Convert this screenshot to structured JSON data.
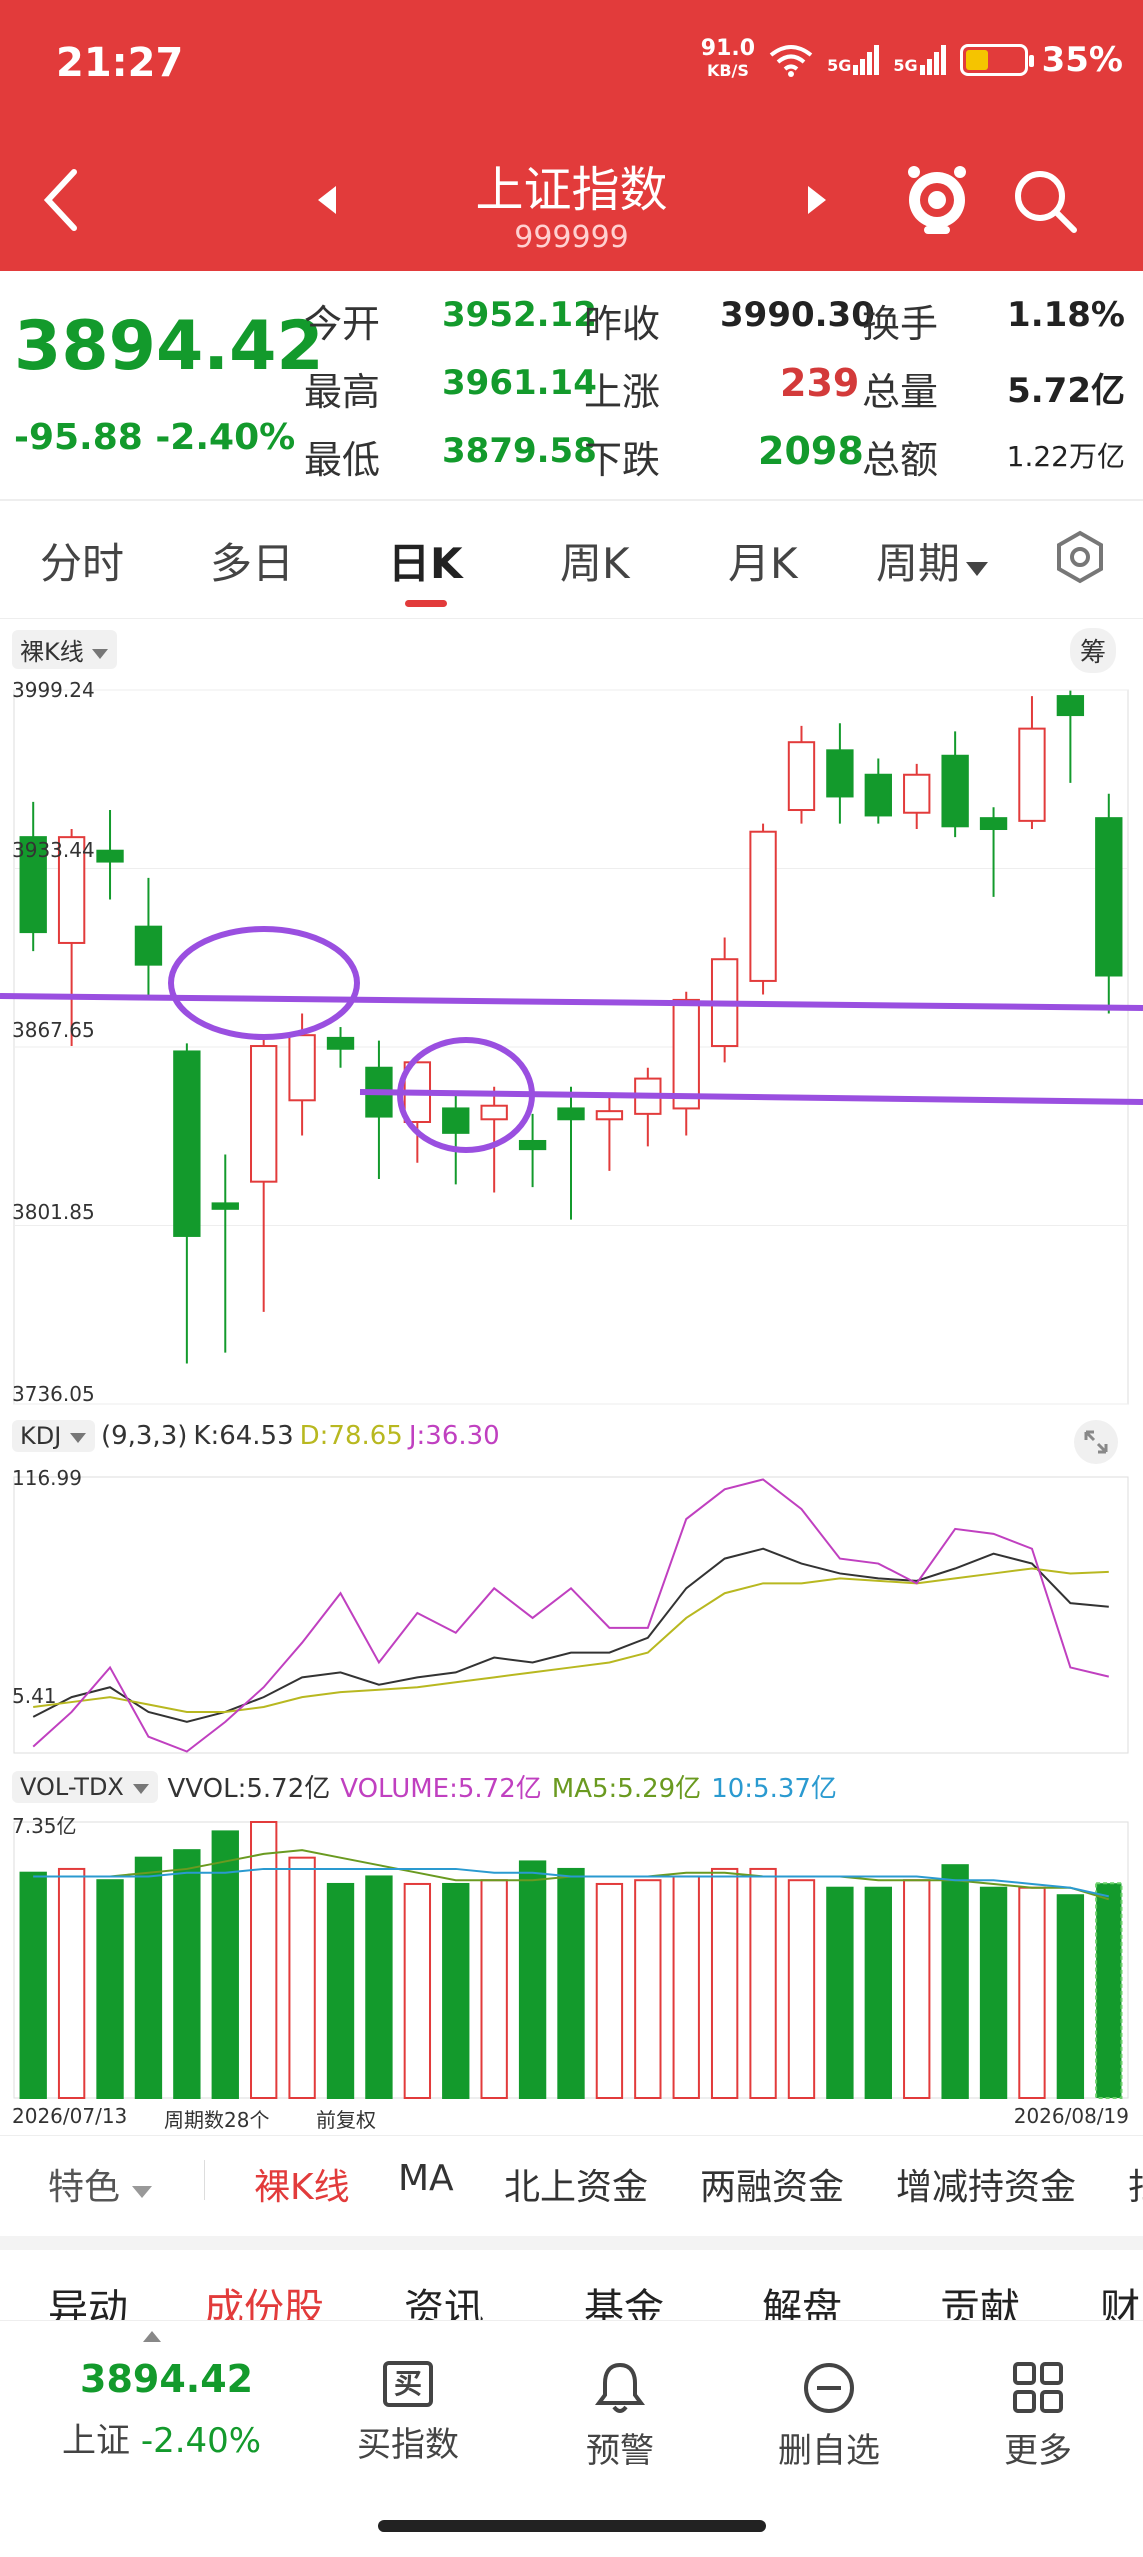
{
  "status_bar": {
    "time": "21:27",
    "speed": "91.0",
    "speed_unit": "KB/S",
    "battery": "35%",
    "network1": "5G",
    "network2": "5G"
  },
  "header": {
    "title": "上证指数",
    "code": "999999"
  },
  "quote": {
    "price": "3894.42",
    "change": "-95.88",
    "change_pct": "-2.40%",
    "open_label": "今开",
    "open": "3952.12",
    "prev_close_label": "昨收",
    "prev_close": "3990.30",
    "turnover_label": "换手",
    "turnover": "1.18%",
    "high_label": "最高",
    "high": "3961.14",
    "up_label": "上涨",
    "up": "239",
    "volume_label": "总量",
    "volume": "5.72亿",
    "low_label": "最低",
    "low": "3879.58",
    "down_label": "下跌",
    "down": "2098",
    "amount_label": "总额",
    "amount": "1.22万亿"
  },
  "tabs": [
    "分时",
    "多日",
    "日K",
    "周K",
    "月K",
    "周期"
  ],
  "kline": {
    "style_label": "裸K线",
    "chip_label": "筹",
    "y_labels": [
      "3999.24",
      "3933.44",
      "3867.65",
      "3801.85",
      "3736.05"
    ],
    "candles": [
      {
        "o": 3945,
        "c": 3910,
        "h": 3958,
        "l": 3903
      },
      {
        "o": 3906,
        "c": 3945,
        "h": 3948,
        "l": 3868
      },
      {
        "o": 3940,
        "c": 3936,
        "h": 3955,
        "l": 3922
      },
      {
        "o": 3912,
        "c": 3898,
        "h": 3930,
        "l": 3885
      },
      {
        "o": 3866,
        "c": 3798,
        "h": 3869,
        "l": 3751
      },
      {
        "o": 3810,
        "c": 3808,
        "h": 3828,
        "l": 3755
      },
      {
        "o": 3818,
        "c": 3868,
        "h": 3872,
        "l": 3770
      },
      {
        "o": 3848,
        "c": 3872,
        "h": 3880,
        "l": 3835
      },
      {
        "o": 3871,
        "c": 3867,
        "h": 3875,
        "l": 3860
      },
      {
        "o": 3860,
        "c": 3842,
        "h": 3870,
        "l": 3819
      },
      {
        "o": 3840,
        "c": 3862,
        "h": 3862,
        "l": 3825
      },
      {
        "o": 3845,
        "c": 3836,
        "h": 3850,
        "l": 3817
      },
      {
        "o": 3841,
        "c": 3846,
        "h": 3853,
        "l": 3814
      },
      {
        "o": 3833,
        "c": 3830,
        "h": 3843,
        "l": 3816
      },
      {
        "o": 3845,
        "c": 3841,
        "h": 3853,
        "l": 3804
      },
      {
        "o": 3841,
        "c": 3844,
        "h": 3850,
        "l": 3822
      },
      {
        "o": 3843,
        "c": 3856,
        "h": 3860,
        "l": 3831
      },
      {
        "o": 3845,
        "c": 3885,
        "h": 3888,
        "l": 3835
      },
      {
        "o": 3868,
        "c": 3900,
        "h": 3908,
        "l": 3862
      },
      {
        "o": 3892,
        "c": 3947,
        "h": 3950,
        "l": 3887
      },
      {
        "o": 3955,
        "c": 3980,
        "h": 3986,
        "l": 3950
      },
      {
        "o": 3977,
        "c": 3960,
        "h": 3987,
        "l": 3950
      },
      {
        "o": 3968,
        "c": 3953,
        "h": 3974,
        "l": 3950
      },
      {
        "o": 3954,
        "c": 3968,
        "h": 3972,
        "l": 3948
      },
      {
        "o": 3975,
        "c": 3949,
        "h": 3984,
        "l": 3945
      },
      {
        "o": 3952,
        "c": 3948,
        "h": 3956,
        "l": 3923
      },
      {
        "o": 3951,
        "c": 3985,
        "h": 3997,
        "l": 3948
      },
      {
        "o": 3997,
        "c": 3990,
        "h": 3999,
        "l": 3965
      },
      {
        "o": 3952,
        "c": 3894,
        "h": 3961,
        "l": 3880
      }
    ]
  },
  "kdj": {
    "label": "KDJ",
    "params": "(9,3,3)",
    "k_text": "K:64.53",
    "d_text": "D:78.65",
    "j_text": "J:36.30",
    "y_max": "116.99",
    "y_min": "5.41",
    "color_k": "#333333",
    "color_d": "#b8b820",
    "color_j": "#c040c0",
    "k": [
      20,
      28,
      32,
      22,
      18,
      22,
      28,
      36,
      38,
      33,
      36,
      38,
      44,
      42,
      46,
      46,
      52,
      72,
      84,
      88,
      82,
      78,
      76,
      75,
      80,
      86,
      82,
      66,
      64.53
    ],
    "d": [
      24,
      26,
      28,
      25,
      22,
      22,
      24,
      28,
      30,
      31,
      32,
      34,
      36,
      38,
      40,
      42,
      46,
      60,
      70,
      74,
      74,
      76,
      75,
      74,
      76,
      78,
      80,
      78,
      78.65
    ],
    "j": [
      8,
      22,
      40,
      12,
      6,
      18,
      32,
      50,
      70,
      42,
      62,
      54,
      72,
      60,
      72,
      56,
      56,
      100,
      112,
      116,
      104,
      84,
      82,
      74,
      96,
      94,
      88,
      40,
      36.3
    ]
  },
  "vol": {
    "label": "VOL-TDX",
    "vvol_text": "VVOL:5.72亿",
    "volume_text": "VOLUME:5.72亿",
    "ma5_text": "MA5:5.29亿",
    "ma10_text": "10:5.37亿",
    "y_max": "7.35亿",
    "date_start": "2026/07/13",
    "period_count": "周期数28个",
    "adjust": "前复权",
    "date_end": "2026/08/19",
    "values": [
      6.0,
      6.1,
      5.8,
      6.4,
      6.6,
      7.1,
      7.35,
      6.4,
      5.7,
      5.9,
      5.7,
      5.7,
      5.8,
      6.3,
      6.1,
      5.7,
      5.8,
      5.9,
      6.1,
      6.1,
      5.8,
      5.6,
      5.6,
      5.8,
      6.2,
      5.6,
      5.6,
      5.4,
      5.72
    ],
    "ma5": [
      5.9,
      5.9,
      5.9,
      6.0,
      6.1,
      6.3,
      6.5,
      6.6,
      6.4,
      6.2,
      6.0,
      5.8,
      5.8,
      5.8,
      5.9,
      5.9,
      5.9,
      6.0,
      6.0,
      5.9,
      5.9,
      5.9,
      5.8,
      5.8,
      5.8,
      5.7,
      5.6,
      5.6,
      5.29
    ],
    "ma10": [
      5.9,
      5.9,
      5.9,
      5.9,
      6.0,
      6.0,
      6.1,
      6.1,
      6.1,
      6.1,
      6.1,
      6.1,
      6.0,
      6.0,
      5.9,
      5.9,
      5.9,
      5.9,
      5.9,
      5.9,
      5.9,
      5.9,
      5.9,
      5.9,
      5.8,
      5.8,
      5.7,
      5.6,
      5.37
    ]
  },
  "indicators": [
    "特色",
    "裸K线",
    "MA",
    "北上资金",
    "两融资金",
    "增减持资金",
    "扫"
  ],
  "sections": [
    "异动",
    "成份股",
    "资讯",
    "基金",
    "解盘",
    "贡献",
    "财"
  ],
  "bottom": {
    "price": "3894.42",
    "name": "上证",
    "change": "-2.40%",
    "buy": "买指数",
    "alert": "预警",
    "remove": "删自选",
    "more": "更多",
    "buy_glyph": "买"
  },
  "colors": {
    "red": "#e23b3b",
    "green": "#139a2c",
    "annotation": "#9a4fe0"
  }
}
